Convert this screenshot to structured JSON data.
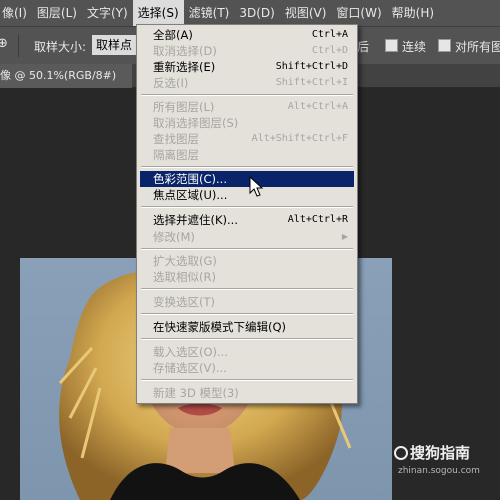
{
  "menubar": {
    "items": [
      "像(I)",
      "图层(L)",
      "文字(Y)",
      "选择(S)",
      "滤镜(T)",
      "3D(D)",
      "视图(V)",
      "窗口(W)",
      "帮助(H)"
    ]
  },
  "options_bar": {
    "tool_glyph": "⊕",
    "sample_size_label": "取样大小:",
    "sample_size_value": "取样点",
    "partial_text": "后",
    "contiguous_label": "连续",
    "all_layers_label": "对所有图"
  },
  "document_tab": {
    "title": "像 @ 50.1%(RGB/8#)"
  },
  "select_menu": {
    "items": [
      {
        "label": "全部(A)",
        "shortcut": "Ctrl+A",
        "enabled": true
      },
      {
        "label": "取消选择(D)",
        "shortcut": "Ctrl+D",
        "enabled": false
      },
      {
        "label": "重新选择(E)",
        "shortcut": "Shift+Ctrl+D",
        "enabled": true
      },
      {
        "label": "反选(I)",
        "shortcut": "Shift+Ctrl+I",
        "enabled": false
      },
      {
        "label": "所有图层(L)",
        "shortcut": "Alt+Ctrl+A",
        "enabled": false
      },
      {
        "label": "取消选择图层(S)",
        "shortcut": "",
        "enabled": false
      },
      {
        "label": "查找图层",
        "shortcut": "Alt+Shift+Ctrl+F",
        "enabled": false
      },
      {
        "label": "隔离图层",
        "shortcut": "",
        "enabled": false
      },
      {
        "label": "色彩范围(C)...",
        "shortcut": "",
        "enabled": true,
        "highlighted": true
      },
      {
        "label": "焦点区域(U)...",
        "shortcut": "",
        "enabled": true
      },
      {
        "label": "选择并遮住(K)...",
        "shortcut": "Alt+Ctrl+R",
        "enabled": true
      },
      {
        "label": "修改(M)",
        "shortcut": "",
        "enabled": false,
        "submenu": true
      },
      {
        "label": "扩大选取(G)",
        "shortcut": "",
        "enabled": false
      },
      {
        "label": "选取相似(R)",
        "shortcut": "",
        "enabled": false
      },
      {
        "label": "变换选区(T)",
        "shortcut": "",
        "enabled": false
      },
      {
        "label": "在快速蒙版模式下编辑(Q)",
        "shortcut": "",
        "enabled": true
      },
      {
        "label": "载入选区(O)...",
        "shortcut": "",
        "enabled": false
      },
      {
        "label": "存储选区(V)...",
        "shortcut": "",
        "enabled": false
      },
      {
        "label": "新建 3D 模型(3)",
        "shortcut": "",
        "enabled": false
      }
    ]
  },
  "watermark": {
    "brand": "搜狗指南",
    "url": "zhinan.sogou.com"
  },
  "colors": {
    "menu_bg": "#e4e1db",
    "highlight": "#0a246a",
    "disabled_text": "#a7a5a0",
    "app_bar": "#535353",
    "canvas_bg": "#8aa0b8"
  }
}
